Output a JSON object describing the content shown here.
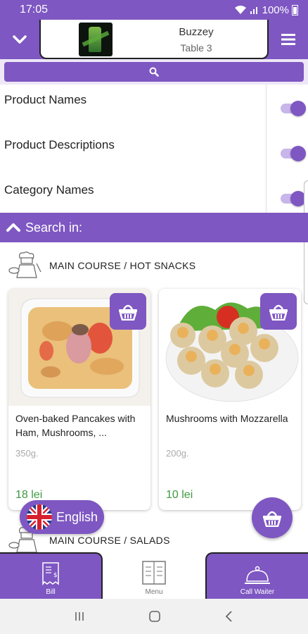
{
  "status": {
    "time": "17:05",
    "battery": "100%"
  },
  "header": {
    "venue_name": "Buzzey",
    "table": "Table 3"
  },
  "search_options": [
    {
      "label": "Product Names",
      "enabled": true
    },
    {
      "label": "Product Descriptions",
      "enabled": true
    },
    {
      "label": "Category Names",
      "enabled": true
    }
  ],
  "search_in_label": "Search in:",
  "categories": [
    {
      "title": "MAIN COURSE / HOT SNACKS"
    },
    {
      "title": "MAIN COURSE / SALADS"
    }
  ],
  "products": [
    {
      "name": "Oven-baked Pancakes with Ham, Mushrooms, ...",
      "weight": "350g.",
      "price": "18 lei"
    },
    {
      "name": "Mushrooms with Mozzarella",
      "weight": "200g.",
      "price": "10 lei"
    }
  ],
  "language": {
    "label": "English"
  },
  "bottom_nav": {
    "bill": "Bill",
    "menu": "Menu",
    "call_waiter": "Call Waiter"
  },
  "colors": {
    "accent": "#7e57c2",
    "price": "#3d9a40"
  }
}
